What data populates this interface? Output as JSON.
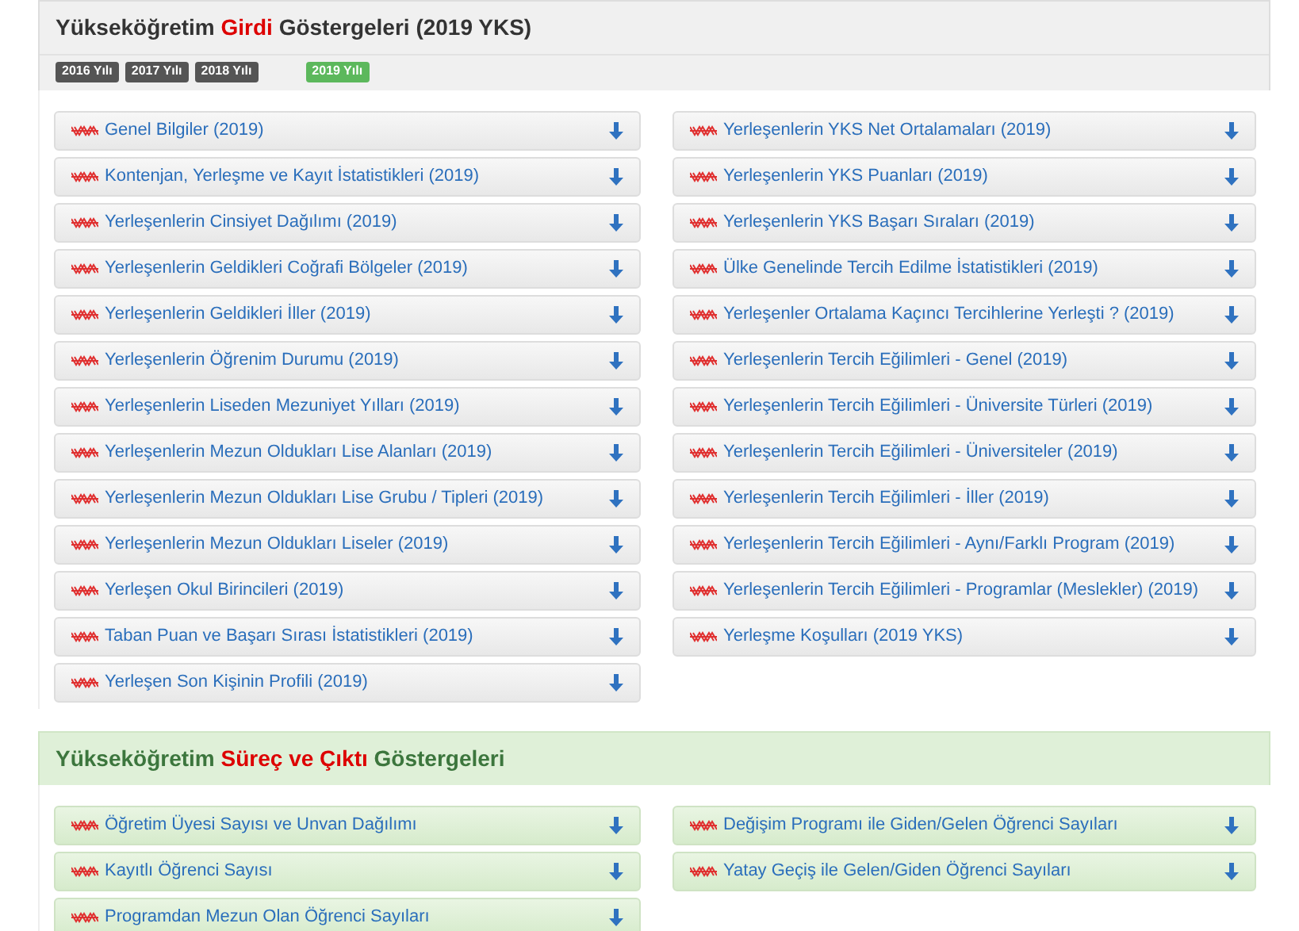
{
  "sections": [
    {
      "kind": "input",
      "title_parts": [
        {
          "text": "Yükseköğretim ",
          "highlight": false
        },
        {
          "text": "Girdi",
          "highlight": true
        },
        {
          "text": " Göstergeleri (2019 YKS)",
          "highlight": false
        }
      ],
      "years": [
        {
          "label": "2016 Yılı",
          "selected": false
        },
        {
          "label": "2017 Yılı",
          "selected": false
        },
        {
          "label": "2018 Yılı",
          "selected": false
        },
        {
          "label": "2019 Yılı",
          "selected": true
        }
      ],
      "left": [
        "Genel Bilgiler (2019)",
        "Kontenjan, Yerleşme ve Kayıt İstatistikleri (2019)",
        "Yerleşenlerin Cinsiyet Dağılımı (2019)",
        "Yerleşenlerin Geldikleri Coğrafi Bölgeler (2019)",
        "Yerleşenlerin Geldikleri İller (2019)",
        "Yerleşenlerin Öğrenim Durumu (2019)",
        "Yerleşenlerin Liseden Mezuniyet Yılları (2019)",
        "Yerleşenlerin Mezun Oldukları Lise Alanları (2019)",
        "Yerleşenlerin Mezun Oldukları Lise Grubu / Tipleri (2019)",
        "Yerleşenlerin Mezun Oldukları Liseler (2019)",
        "Yerleşen Okul Birincileri (2019)",
        "Taban Puan ve Başarı Sırası İstatistikleri (2019)",
        "Yerleşen Son Kişinin Profili (2019)"
      ],
      "right": [
        "Yerleşenlerin YKS Net Ortalamaları (2019)",
        "Yerleşenlerin YKS Puanları (2019)",
        "Yerleşenlerin YKS Başarı Sıraları (2019)",
        "Ülke Genelinde Tercih Edilme İstatistikleri (2019)",
        "Yerleşenler Ortalama Kaçıncı Tercihlerine Yerleşti ? (2019)",
        "Yerleşenlerin Tercih Eğilimleri - Genel (2019)",
        "Yerleşenlerin Tercih Eğilimleri - Üniversite Türleri (2019)",
        "Yerleşenlerin Tercih Eğilimleri - Üniversiteler (2019)",
        "Yerleşenlerin Tercih Eğilimleri - İller (2019)",
        "Yerleşenlerin Tercih Eğilimleri - Aynı/Farklı Program (2019)",
        "Yerleşenlerin Tercih Eğilimleri - Programlar (Meslekler) (2019)",
        "Yerleşme Koşulları (2019 YKS)"
      ]
    },
    {
      "kind": "output",
      "title_parts": [
        {
          "text": "Yükseköğretim ",
          "highlight": false
        },
        {
          "text": "Süreç ve Çıktı",
          "highlight": true
        },
        {
          "text": " Göstergeleri",
          "highlight": false
        }
      ],
      "left": [
        "Öğretim Üyesi Sayısı ve Unvan Dağılımı",
        "Kayıtlı Öğrenci Sayısı",
        "Programdan Mezun Olan Öğrenci Sayıları"
      ],
      "right": [
        "Değişim Programı ile Giden/Gelen Öğrenci Sayıları",
        "Yatay Geçiş ile Gelen/Giden Öğrenci Sayıları"
      ]
    }
  ]
}
